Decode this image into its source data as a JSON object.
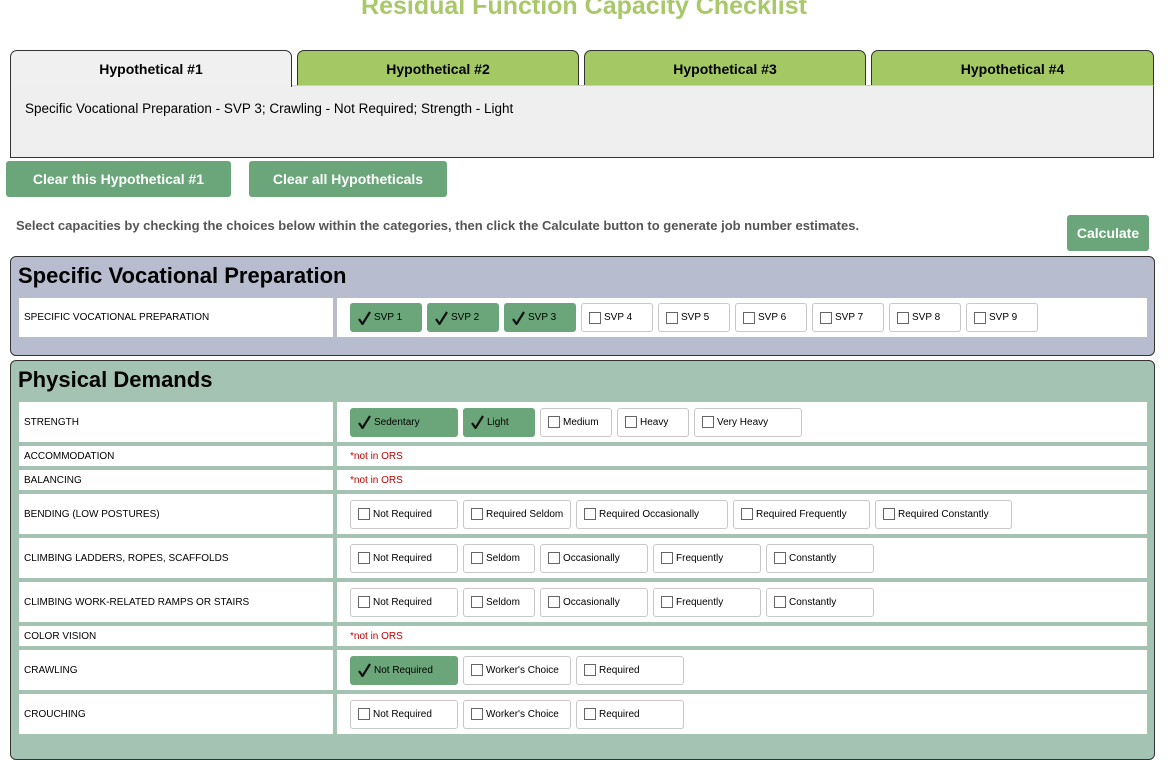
{
  "title": "Residual Function Capacity Checklist",
  "tabs": [
    {
      "label": "Hypothetical #1",
      "active": true
    },
    {
      "label": "Hypothetical #2",
      "active": false
    },
    {
      "label": "Hypothetical #3",
      "active": false
    },
    {
      "label": "Hypothetical #4",
      "active": false
    }
  ],
  "summary": "Specific Vocational Preparation - SVP 3; Crawling - Not Required; Strength - Light",
  "buttons": {
    "clear_one": "Clear this Hypothetical #1",
    "clear_all": "Clear all Hypotheticals",
    "calculate": "Calculate"
  },
  "instructions": "Select capacities by checking the choices below within the categories, then click the Calculate button to generate job number estimates.",
  "colors": {
    "title": "#a8c86a",
    "tab_inactive": "#a3c864",
    "button": "#6aa67a",
    "checked": "#6aa67a",
    "svp_section_bg": "#b8bccf",
    "physical_section_bg": "#a5c3b2",
    "note": "#c00000"
  },
  "sections": [
    {
      "title": "Specific Vocational Preparation",
      "rows": [
        {
          "label": "SPECIFIC VOCATIONAL PREPARATION",
          "options": [
            {
              "label": "SVP 1",
              "checked": true
            },
            {
              "label": "SVP 2",
              "checked": true
            },
            {
              "label": "SVP 3",
              "checked": true
            },
            {
              "label": "SVP 4",
              "checked": false
            },
            {
              "label": "SVP 5",
              "checked": false
            },
            {
              "label": "SVP 6",
              "checked": false
            },
            {
              "label": "SVP 7",
              "checked": false
            },
            {
              "label": "SVP 8",
              "checked": false
            },
            {
              "label": "SVP 9",
              "checked": false
            }
          ]
        }
      ]
    },
    {
      "title": "Physical Demands",
      "rows": [
        {
          "label": "STRENGTH",
          "options": [
            {
              "label": "Sedentary",
              "checked": true
            },
            {
              "label": "Light",
              "checked": true
            },
            {
              "label": "Medium",
              "checked": false
            },
            {
              "label": "Heavy",
              "checked": false
            },
            {
              "label": "Very Heavy",
              "checked": false
            }
          ]
        },
        {
          "label": "ACCOMMODATION",
          "note": "*not in ORS"
        },
        {
          "label": "BALANCING",
          "note": "*not in ORS"
        },
        {
          "label": "BENDING (LOW POSTURES)",
          "options": [
            {
              "label": "Not Required",
              "checked": false
            },
            {
              "label": "Required Seldom",
              "checked": false
            },
            {
              "label": "Required Occasionally",
              "checked": false
            },
            {
              "label": "Required Frequently",
              "checked": false
            },
            {
              "label": "Required Constantly",
              "checked": false
            }
          ]
        },
        {
          "label": "CLIMBING LADDERS, ROPES, SCAFFOLDS",
          "options": [
            {
              "label": "Not Required",
              "checked": false
            },
            {
              "label": "Seldom",
              "checked": false
            },
            {
              "label": "Occasionally",
              "checked": false
            },
            {
              "label": "Frequently",
              "checked": false
            },
            {
              "label": "Constantly",
              "checked": false
            }
          ]
        },
        {
          "label": "CLIMBING WORK-RELATED RAMPS OR STAIRS",
          "options": [
            {
              "label": "Not Required",
              "checked": false
            },
            {
              "label": "Seldom",
              "checked": false
            },
            {
              "label": "Occasionally",
              "checked": false
            },
            {
              "label": "Frequently",
              "checked": false
            },
            {
              "label": "Constantly",
              "checked": false
            }
          ]
        },
        {
          "label": "COLOR VISION",
          "note": "*not in ORS"
        },
        {
          "label": "CRAWLING",
          "options": [
            {
              "label": "Not Required",
              "checked": true
            },
            {
              "label": "Worker's Choice",
              "checked": false
            },
            {
              "label": "Required",
              "checked": false
            }
          ]
        },
        {
          "label": "CROUCHING",
          "options": [
            {
              "label": "Not Required",
              "checked": false
            },
            {
              "label": "Worker's Choice",
              "checked": false
            },
            {
              "label": "Required",
              "checked": false
            }
          ]
        }
      ]
    }
  ]
}
